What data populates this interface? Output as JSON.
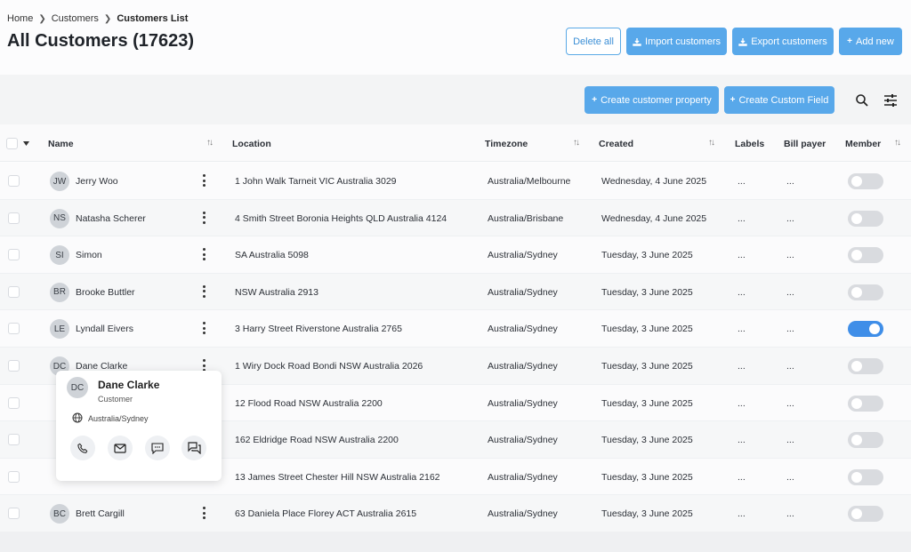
{
  "breadcrumb": {
    "home": "Home",
    "customers": "Customers",
    "current": "Customers List"
  },
  "page_title": "All Customers (17623)",
  "actions": {
    "delete_all": "Delete all",
    "import": "Import customers",
    "export": "Export customers",
    "add_new": "Add new"
  },
  "toolbar": {
    "create_property": "Create customer property",
    "create_field": "Create Custom Field"
  },
  "columns": {
    "name": "Name",
    "location": "Location",
    "timezone": "Timezone",
    "created": "Created",
    "labels": "Labels",
    "bill_payer": "Bill payer",
    "member": "Member"
  },
  "rows": [
    {
      "initials": "JW",
      "name": "Jerry Woo",
      "location": "1 John Walk Tarneit VIC Australia 3029",
      "timezone": "Australia/Melbourne",
      "created": "Wednesday, 4 June 2025",
      "labels": "...",
      "bill_payer": "...",
      "member": false
    },
    {
      "initials": "NS",
      "name": "Natasha Scherer",
      "location": "4 Smith Street Boronia Heights QLD Australia 4124",
      "timezone": "Australia/Brisbane",
      "created": "Wednesday, 4 June 2025",
      "labels": "...",
      "bill_payer": "...",
      "member": false
    },
    {
      "initials": "SI",
      "name": "Simon",
      "location": "SA Australia 5098",
      "timezone": "Australia/Sydney",
      "created": "Tuesday, 3 June 2025",
      "labels": "...",
      "bill_payer": "...",
      "member": false
    },
    {
      "initials": "BR",
      "name": "Brooke Buttler",
      "location": "NSW Australia 2913",
      "timezone": "Australia/Sydney",
      "created": "Tuesday, 3 June 2025",
      "labels": "...",
      "bill_payer": "...",
      "member": false
    },
    {
      "initials": "LE",
      "name": "Lyndall Eivers",
      "location": "3 Harry Street Riverstone Australia 2765",
      "timezone": "Australia/Sydney",
      "created": "Tuesday, 3 June 2025",
      "labels": "...",
      "bill_payer": "...",
      "member": true
    },
    {
      "initials": "DC",
      "name": "Dane Clarke",
      "location": "1 Wiry Dock Road Bondi NSW Australia 2026",
      "timezone": "Australia/Sydney",
      "created": "Tuesday, 3 June 2025",
      "labels": "...",
      "bill_payer": "...",
      "member": false
    },
    {
      "initials": "",
      "name": "",
      "location": "12 Flood Road NSW Australia 2200",
      "timezone": "Australia/Sydney",
      "created": "Tuesday, 3 June 2025",
      "labels": "...",
      "bill_payer": "...",
      "member": false
    },
    {
      "initials": "",
      "name": "",
      "location": "162 Eldridge Road NSW Australia 2200",
      "timezone": "Australia/Sydney",
      "created": "Tuesday, 3 June 2025",
      "labels": "...",
      "bill_payer": "...",
      "member": false
    },
    {
      "initials": "",
      "name": "",
      "location": "13 James Street Chester Hill NSW Australia 2162",
      "timezone": "Australia/Sydney",
      "created": "Tuesday, 3 June 2025",
      "labels": "...",
      "bill_payer": "...",
      "member": false
    },
    {
      "initials": "BC",
      "name": "Brett Cargill",
      "location": "63 Daniela Place Florey ACT Australia 2615",
      "timezone": "Australia/Sydney",
      "created": "Tuesday, 3 June 2025",
      "labels": "...",
      "bill_payer": "...",
      "member": false
    }
  ],
  "popover": {
    "initials": "DC",
    "name": "Dane Clarke",
    "role": "Customer",
    "timezone": "Australia/Sydney",
    "actions": [
      "phone-icon",
      "mail-icon",
      "sms-icon",
      "chat-icon"
    ]
  },
  "colors": {
    "primary": "#58a8ea",
    "toggle_on": "#3f8ee8",
    "toggle_off": "#d9dbdf"
  }
}
